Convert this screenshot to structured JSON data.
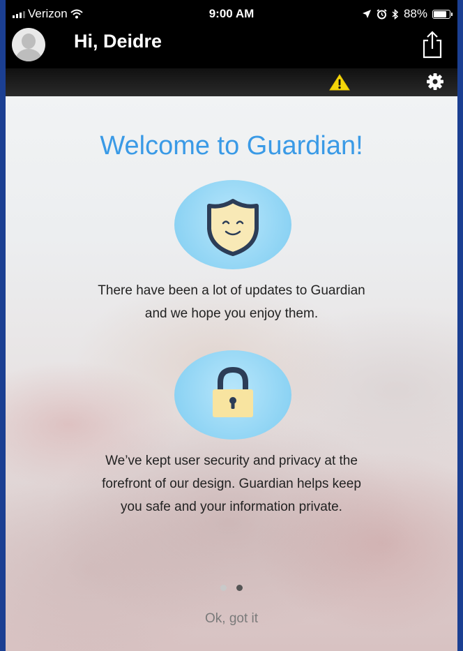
{
  "status_bar": {
    "carrier": "Verizon",
    "time": "9:00 AM",
    "battery": "88%",
    "battery_level": 0.88
  },
  "header": {
    "greeting": "Hi, Deidre"
  },
  "colors": {
    "accent": "#3a9ae6",
    "warning": "#f5d60a",
    "header_bg": "#000000"
  },
  "welcome": {
    "title": "Welcome to Guardian!",
    "updates_text": "There have been a lot of updates to Guardian and we hope you enjoy them.",
    "updates_line1": "There have been a lot of updates to Guardian",
    "updates_line2": "and we hope you enjoy them.",
    "security_line1": "We’ve kept user security and privacy at the",
    "security_line2": "forefront of our design. Guardian helps keep",
    "security_line3": "you safe and your information private."
  },
  "pager": {
    "total": 2,
    "current": 2
  },
  "actions": {
    "ok_label": "Ok, got it"
  },
  "icons": {
    "avatar": "person-avatar-icon",
    "share": "share-icon",
    "warning": "warning-triangle-icon",
    "settings": "gear-icon",
    "shield": "smiling-shield-icon",
    "lock": "padlock-icon"
  }
}
